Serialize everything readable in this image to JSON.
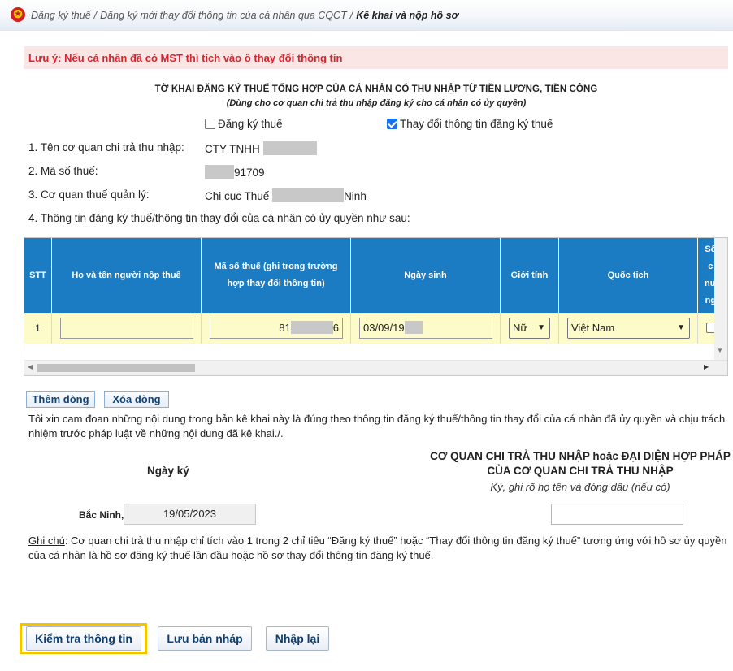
{
  "breadcrumb": {
    "items": [
      "Đăng ký thuế",
      "Đăng ký mới thay đổi thông tin của cá nhân qua CQCT"
    ],
    "current": "Kê khai và nộp hồ sơ"
  },
  "notice": "Lưu ý: Nếu cá nhân đã có MST thì tích vào ô thay đổi thông tin",
  "form": {
    "title": "TỜ KHAI ĐĂNG KÝ THUẾ TỔNG HỢP CỦA CÁ NHÂN CÓ THU NHẬP TỪ TIỀN LƯƠNG, TIỀN CÔNG",
    "subtitle": "(Dùng cho cơ quan chi trả thu nhập đăng ký cho cá nhân có ủy quyền)",
    "option_register": {
      "label": "Đăng ký thuế",
      "checked": false
    },
    "option_change": {
      "label": "Thay đổi thông tin đăng ký thuế",
      "checked": true
    },
    "field1_label": "1. Tên cơ quan chi trả thu nhập:",
    "field1_value": "CTY TNHH",
    "field2_label": "2. Mã số thuế:",
    "field2_value": "91709",
    "field3_label": "3. Cơ quan thuế quản lý:",
    "field3_value_prefix": "Chi cục Thuế",
    "field3_value_suffix": "Ninh",
    "field4_label": "4. Thông tin đăng ký thuế/thông tin thay đổi của cá nhân có ủy quyền như sau:"
  },
  "table": {
    "headers": {
      "stt": "STT",
      "name": "Họ và tên người nộp thuế",
      "tax_code": "Mã số thuế (ghi trong trường hợp thay đổi thông tin)",
      "dob": "Ngày sinh",
      "gender": "Giới tính",
      "nationality": "Quốc tịch",
      "last_col": "Số\nc\nnư\nng"
    },
    "row": {
      "stt": "1",
      "name": "",
      "tax_code_prefix": "81",
      "tax_code_suffix": "6",
      "dob_prefix": "03/09/19",
      "gender": "Nữ",
      "nationality": "Việt Nam"
    }
  },
  "buttons": {
    "add_row": "Thêm dòng",
    "delete_row": "Xóa dòng",
    "check": "Kiểm tra thông tin",
    "save_draft": "Lưu bản nháp",
    "reset": "Nhập lại"
  },
  "declaration": "Tôi xin cam đoan những nội dung trong bản kê khai này là đúng theo thông tin đăng ký thuế/thông tin thay đổi của cá nhân đã ủy quyền và chịu trách nhiệm trước pháp luật về những nội dung đã kê khai./.",
  "signing": {
    "date_heading": "Ngày ký",
    "place": "Bắc Ninh,",
    "date": "19/05/2023",
    "org_heading_line1": "CƠ QUAN CHI TRẢ THU NHẬP hoặc ĐẠI DIỆN HỢP PHÁP",
    "org_heading_line2": "CỦA CƠ QUAN CHI TRẢ THU NHẬP",
    "org_note": "Ký, ghi rõ họ tên và đóng dấu (nếu có)",
    "signer_value": ""
  },
  "note": {
    "label": "Ghi chú",
    "text": ": Cơ quan chi trả thu nhập chỉ tích vào 1 trong 2 chỉ tiêu “Đăng ký thuế” hoặc “Thay đổi thông tin đăng ký thuế” tương ứng với hồ sơ ủy quyền của cá nhân là hồ sơ đăng ký thuế lần đầu hoặc hồ sơ thay đổi thông tin đăng ký thuế."
  },
  "colors": {
    "header_blue": "#1b7cc3",
    "row_yellow": "#fdfbc9",
    "notice_red": "#d9232d",
    "highlight_border": "#f2c500"
  }
}
